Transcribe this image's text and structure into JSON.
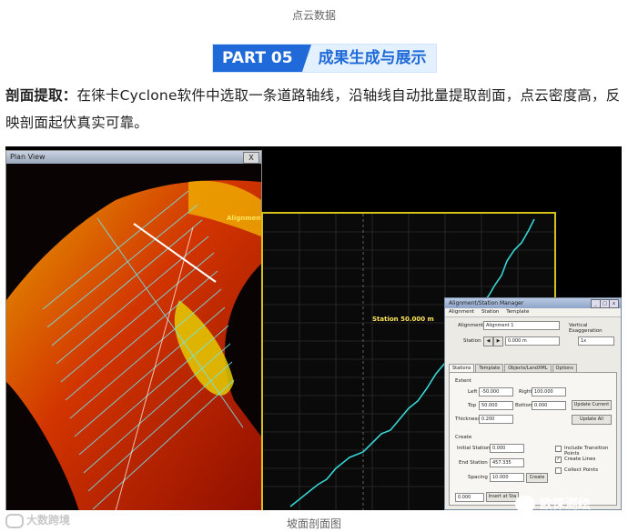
{
  "caption_top": "点云数据",
  "banner": {
    "part": "PART 05",
    "title": "成果生成与展示"
  },
  "paragraph": {
    "lead": "剖面提取：",
    "text": "在徕卡Cyclone软件中选取一条道路轴线，沿轴线自动批量提取剖面，点云密度高，反映剖面起伏真实可靠。"
  },
  "screenshot": {
    "left_window": {
      "title": "Plan View",
      "close": "X",
      "alignment_label": "Alignment"
    },
    "profile": {
      "station_label": "Station 50.000 m"
    },
    "dialog": {
      "title": "Alignment/Station Manager",
      "menu": [
        "Alignment",
        "Station",
        "Template"
      ],
      "alignment_label": "Alignment",
      "alignment_value": "Alignment 1",
      "vertical_exag_label": "Vertical Exaggeration",
      "vertical_exag_value": "1x",
      "station_label": "Station",
      "station_value": "0.000 m",
      "tabs": [
        "Stations",
        "Template",
        "Objects/LandXML",
        "Options"
      ],
      "extent_label": "Extent",
      "left_label": "Left",
      "left_value": "-50.000",
      "right_label": "Right",
      "right_value": "100.000",
      "top_label": "Top",
      "top_value": "50.000",
      "bottom_label": "Bottom",
      "bottom_value": "0.000",
      "thickness_label": "Thickness",
      "thickness_value": "0.200",
      "update_current": "Update Current",
      "update_all": "Update All",
      "create_label": "Create",
      "initial_station_label": "Initial Station",
      "initial_station_value": "0.000",
      "end_station_label": "End Station",
      "end_station_value": "457.335",
      "spacing_label": "Spacing",
      "spacing_value": "10.000",
      "create_button": "Create",
      "include_transition": "Include Transition Points",
      "create_lines": "Create Lines",
      "collect_points": "Collect Points",
      "insert_button": "Insert at Sta"
    }
  },
  "watermark_left": "大数跨境",
  "watermark_right": "欧徕测绘",
  "caption_bottom": "坡面剖面图"
}
